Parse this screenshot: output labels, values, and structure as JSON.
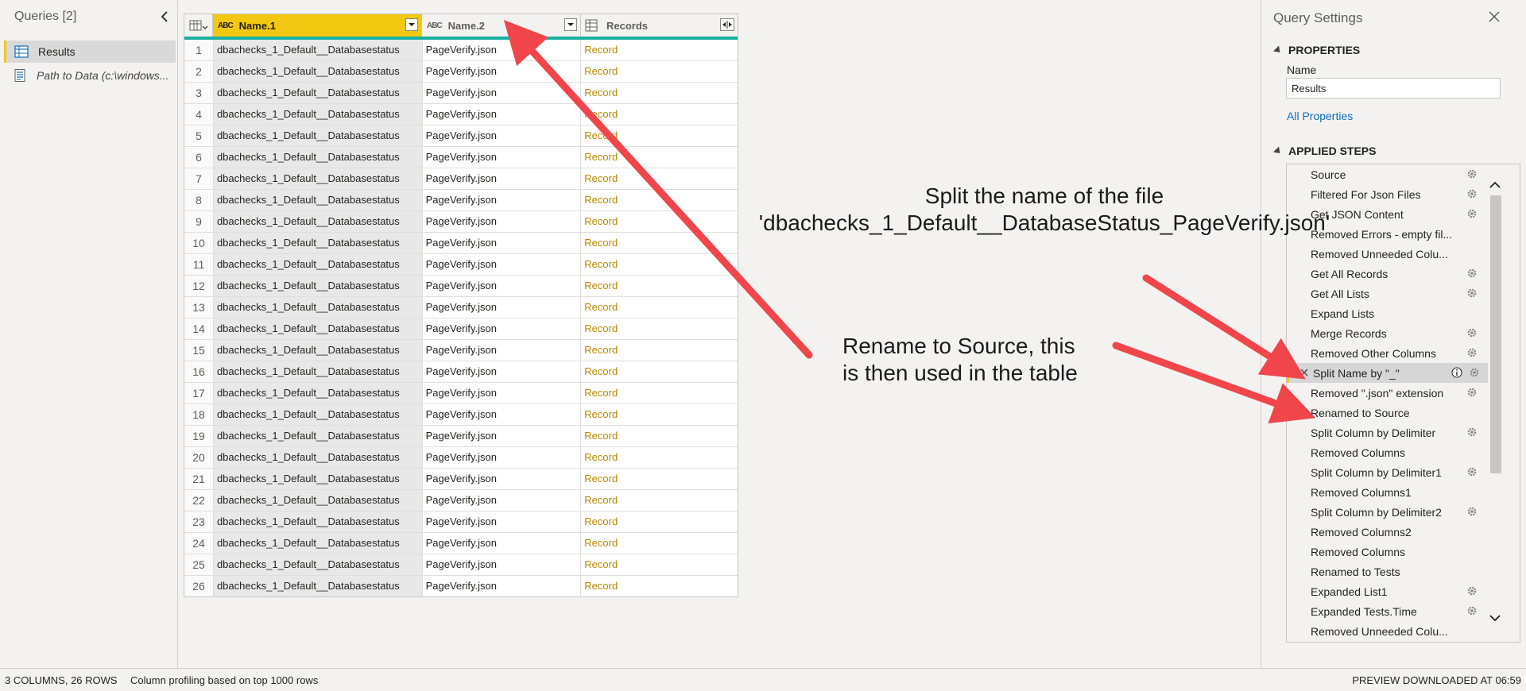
{
  "queries_pane": {
    "header": "Queries [2]",
    "items": [
      {
        "label": "Results",
        "selected": true,
        "icon": "table-icon"
      },
      {
        "label": "Path to Data (c:\\windows...",
        "selected": false,
        "icon": "parameter-icon"
      }
    ]
  },
  "grid": {
    "columns": [
      {
        "type": "ABC",
        "name": "Name.1"
      },
      {
        "type": "ABC",
        "name": "Name.2"
      },
      {
        "type": "",
        "name": "Records"
      }
    ],
    "rows": [
      {
        "n": "1",
        "name1": "dbachecks_1_Default__Databasestatus",
        "name2": "PageVerify.json",
        "records": "Record"
      },
      {
        "n": "2",
        "name1": "dbachecks_1_Default__Databasestatus",
        "name2": "PageVerify.json",
        "records": "Record"
      },
      {
        "n": "3",
        "name1": "dbachecks_1_Default__Databasestatus",
        "name2": "PageVerify.json",
        "records": "Record"
      },
      {
        "n": "4",
        "name1": "dbachecks_1_Default__Databasestatus",
        "name2": "PageVerify.json",
        "records": "Record"
      },
      {
        "n": "5",
        "name1": "dbachecks_1_Default__Databasestatus",
        "name2": "PageVerify.json",
        "records": "Record"
      },
      {
        "n": "6",
        "name1": "dbachecks_1_Default__Databasestatus",
        "name2": "PageVerify.json",
        "records": "Record"
      },
      {
        "n": "7",
        "name1": "dbachecks_1_Default__Databasestatus",
        "name2": "PageVerify.json",
        "records": "Record"
      },
      {
        "n": "8",
        "name1": "dbachecks_1_Default__Databasestatus",
        "name2": "PageVerify.json",
        "records": "Record"
      },
      {
        "n": "9",
        "name1": "dbachecks_1_Default__Databasestatus",
        "name2": "PageVerify.json",
        "records": "Record"
      },
      {
        "n": "10",
        "name1": "dbachecks_1_Default__Databasestatus",
        "name2": "PageVerify.json",
        "records": "Record"
      },
      {
        "n": "11",
        "name1": "dbachecks_1_Default__Databasestatus",
        "name2": "PageVerify.json",
        "records": "Record"
      },
      {
        "n": "12",
        "name1": "dbachecks_1_Default__Databasestatus",
        "name2": "PageVerify.json",
        "records": "Record"
      },
      {
        "n": "13",
        "name1": "dbachecks_1_Default__Databasestatus",
        "name2": "PageVerify.json",
        "records": "Record"
      },
      {
        "n": "14",
        "name1": "dbachecks_1_Default__Databasestatus",
        "name2": "PageVerify.json",
        "records": "Record"
      },
      {
        "n": "15",
        "name1": "dbachecks_1_Default__Databasestatus",
        "name2": "PageVerify.json",
        "records": "Record"
      },
      {
        "n": "16",
        "name1": "dbachecks_1_Default__Databasestatus",
        "name2": "PageVerify.json",
        "records": "Record"
      },
      {
        "n": "17",
        "name1": "dbachecks_1_Default__Databasestatus",
        "name2": "PageVerify.json",
        "records": "Record"
      },
      {
        "n": "18",
        "name1": "dbachecks_1_Default__Databasestatus",
        "name2": "PageVerify.json",
        "records": "Record"
      },
      {
        "n": "19",
        "name1": "dbachecks_1_Default__Databasestatus",
        "name2": "PageVerify.json",
        "records": "Record"
      },
      {
        "n": "20",
        "name1": "dbachecks_1_Default__Databasestatus",
        "name2": "PageVerify.json",
        "records": "Record"
      },
      {
        "n": "21",
        "name1": "dbachecks_1_Default__Databasestatus",
        "name2": "PageVerify.json",
        "records": "Record"
      },
      {
        "n": "22",
        "name1": "dbachecks_1_Default__Databasestatus",
        "name2": "PageVerify.json",
        "records": "Record"
      },
      {
        "n": "23",
        "name1": "dbachecks_1_Default__Databasestatus",
        "name2": "PageVerify.json",
        "records": "Record"
      },
      {
        "n": "24",
        "name1": "dbachecks_1_Default__Databasestatus",
        "name2": "PageVerify.json",
        "records": "Record"
      },
      {
        "n": "25",
        "name1": "dbachecks_1_Default__Databasestatus",
        "name2": "PageVerify.json",
        "records": "Record"
      },
      {
        "n": "26",
        "name1": "dbachecks_1_Default__Databasestatus",
        "name2": "PageVerify.json",
        "records": "Record"
      }
    ]
  },
  "settings": {
    "title": "Query Settings",
    "properties_title": "PROPERTIES",
    "name_label": "Name",
    "name_value": "Results",
    "all_properties": "All Properties",
    "applied_steps_title": "APPLIED STEPS",
    "steps": [
      {
        "label": "Source",
        "gear": true
      },
      {
        "label": "Filtered For Json Files",
        "gear": true
      },
      {
        "label": "Get JSON Content",
        "gear": true
      },
      {
        "label": "Removed Errors - empty fil...",
        "gear": false
      },
      {
        "label": "Removed Unneeded Colu...",
        "gear": false
      },
      {
        "label": "Get All Records",
        "gear": true
      },
      {
        "label": "Get All Lists",
        "gear": true
      },
      {
        "label": "Expand Lists",
        "gear": false
      },
      {
        "label": "Merge Records",
        "gear": true
      },
      {
        "label": "Removed Other Columns",
        "gear": true
      },
      {
        "label": "Split Name by \"_\"",
        "gear": true,
        "selected": true
      },
      {
        "label": "Removed \".json\" extension",
        "gear": true
      },
      {
        "label": "Renamed to Source",
        "gear": false
      },
      {
        "label": "Split Column by Delimiter",
        "gear": true
      },
      {
        "label": "Removed Columns",
        "gear": false
      },
      {
        "label": "Split Column by Delimiter1",
        "gear": true
      },
      {
        "label": "Removed Columns1",
        "gear": false
      },
      {
        "label": "Split Column by Delimiter2",
        "gear": true
      },
      {
        "label": "Removed Columns2",
        "gear": false
      },
      {
        "label": "Removed Columns",
        "gear": false
      },
      {
        "label": "Renamed to Tests",
        "gear": false
      },
      {
        "label": "Expanded List1",
        "gear": true
      },
      {
        "label": "Expanded Tests.Time",
        "gear": true
      },
      {
        "label": "Removed Unneeded Colu...",
        "gear": false
      }
    ]
  },
  "status_bar": {
    "columns_rows": "3 COLUMNS, 26 ROWS",
    "profiling": "Column profiling based on top 1000 rows",
    "preview": "PREVIEW DOWNLOADED AT 06:59"
  },
  "annotations": {
    "split_line1": "Split the name of the file",
    "split_line2": "'dbachecks_1_Default__DatabaseStatus_PageVerify.json'",
    "rename_line1": "Rename to Source, this",
    "rename_line2": "is then used in the table"
  },
  "colors": {
    "accent_yellow": "#f2c811",
    "header_underline": "#1aafa0",
    "record_link": "#b98a00",
    "arrow_red": "#f0464b",
    "link_blue": "#106ebe"
  }
}
